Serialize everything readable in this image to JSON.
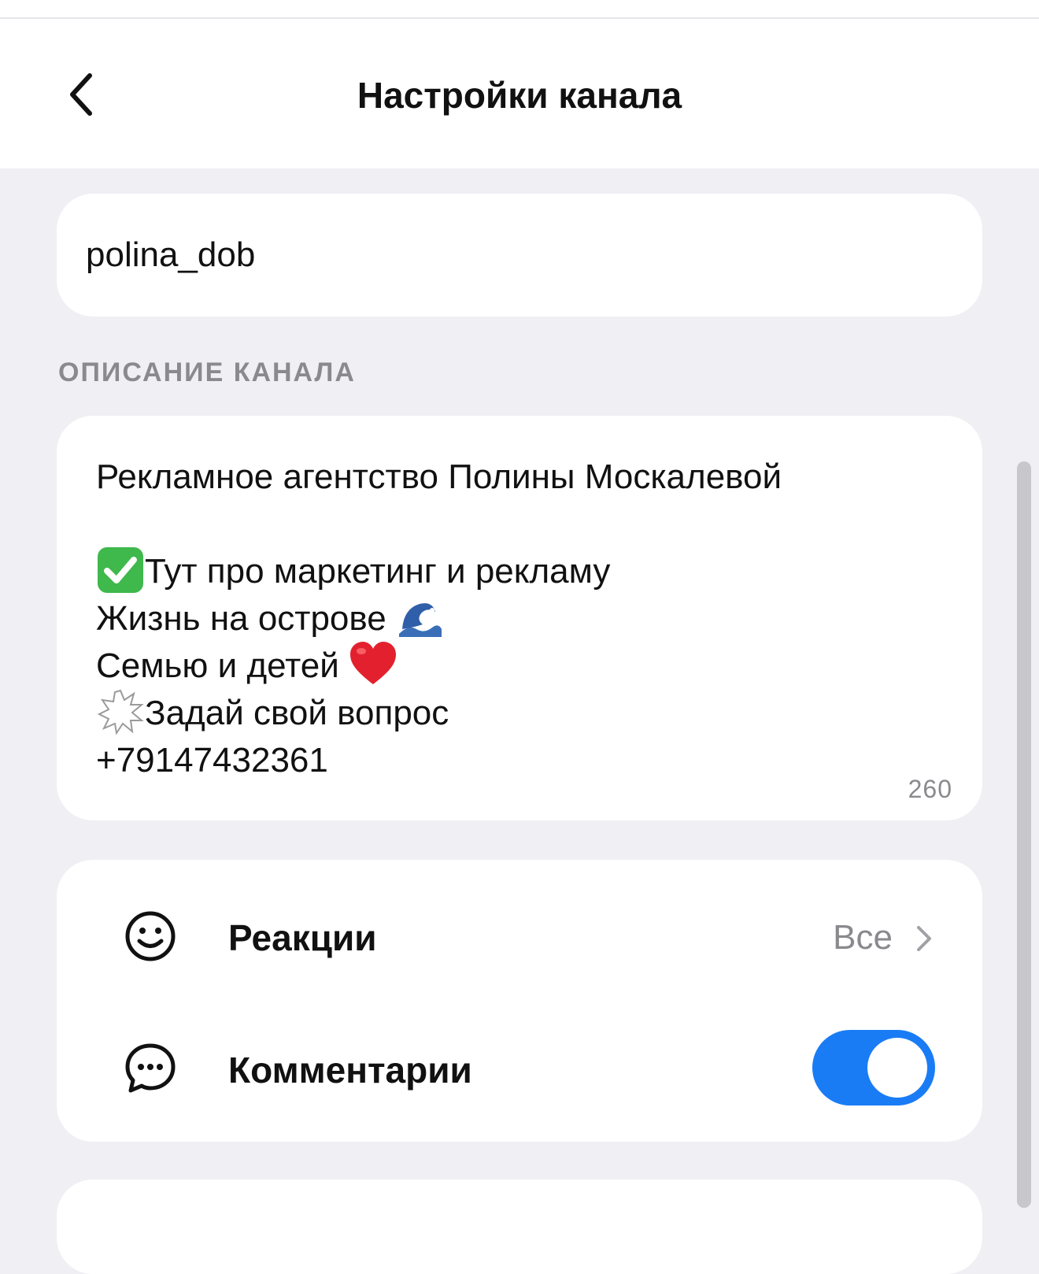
{
  "header": {
    "title": "Настройки канала"
  },
  "channel_name": {
    "value": "polina_dob"
  },
  "description_section": {
    "label": "ОПИСАНИЕ КАНАЛА",
    "lines": [
      "Рекламное агентство Полины Москалевой",
      "",
      "Тут про маркетинг и рекламу",
      "Жизнь на острове",
      "Семью и детей",
      "Задай свой вопрос",
      "+79147432361"
    ],
    "char_count": "260"
  },
  "settings": {
    "reactions": {
      "label": "Реакции",
      "value": "Все",
      "icon": "smiley-icon"
    },
    "comments": {
      "label": "Комментарии",
      "enabled": true,
      "icon": "comment-bubble-icon"
    }
  },
  "colors": {
    "background": "#EFEFF4",
    "card": "#FFFFFF",
    "accent": "#1A7CF5",
    "secondary_text": "#8A8A8E"
  }
}
